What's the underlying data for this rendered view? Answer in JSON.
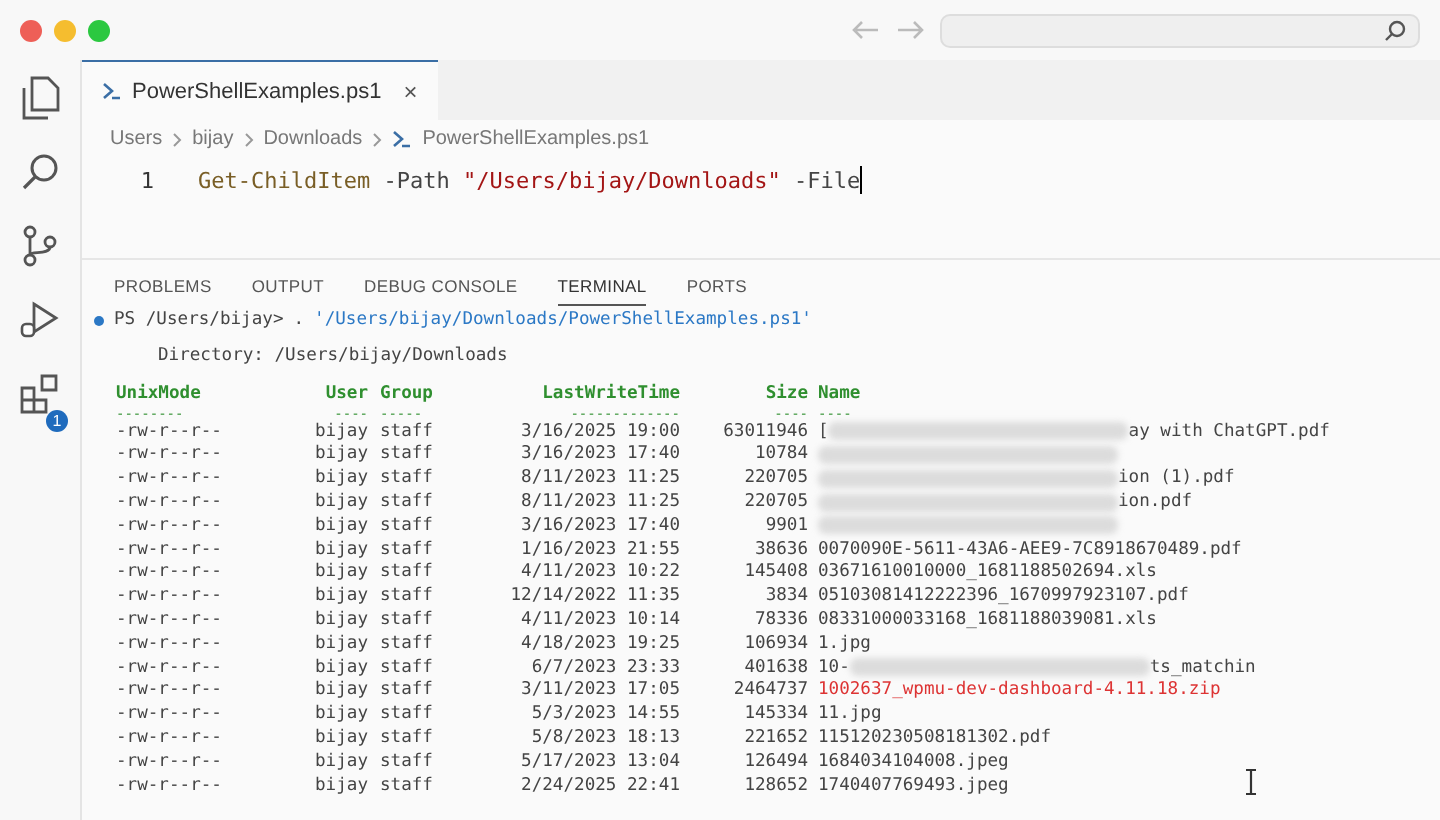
{
  "activity_bar": [
    {
      "kind": "files",
      "selected": false
    },
    {
      "kind": "search",
      "selected": false
    },
    {
      "kind": "branch",
      "selected": false
    },
    {
      "kind": "run",
      "selected": false
    },
    {
      "kind": "extensions",
      "selected": false,
      "badge": "1"
    }
  ],
  "editor_tab": {
    "label": "PowerShellExamples.ps1",
    "close": "×"
  },
  "breadcrumb": [
    "Users",
    "bijay",
    "Downloads",
    "PowerShellExamples.ps1"
  ],
  "code": {
    "line_number": "1",
    "tokens": [
      {
        "kind": "cmd",
        "text": "Get-ChildItem"
      },
      {
        "kind": "param",
        "text": "-Path"
      },
      {
        "kind": "string",
        "text": "\"/Users/bijay/Downloads\""
      },
      {
        "kind": "param",
        "text": "-File"
      }
    ]
  },
  "panel_tabs": [
    {
      "label": "PROBLEMS",
      "selected": false
    },
    {
      "label": "OUTPUT",
      "selected": false
    },
    {
      "label": "DEBUG CONSOLE",
      "selected": false
    },
    {
      "label": "TERMINAL",
      "selected": true
    },
    {
      "label": "PORTS",
      "selected": false
    }
  ],
  "terminal": {
    "prompt": "PS /Users/bijay>",
    "command": ".",
    "argument": "'/Users/bijay/Downloads/PowerShellExamples.ps1'",
    "directory": "Directory: /Users/bijay/Downloads",
    "columns": [
      {
        "label": "UnixMode",
        "underline": "--------"
      },
      {
        "label": "User",
        "underline": "----"
      },
      {
        "label": "Group",
        "underline": "-----"
      },
      {
        "label": "LastWriteTime",
        "underline": "-------------"
      },
      {
        "label": "Size",
        "underline": "----"
      },
      {
        "label": "Name",
        "underline": "----"
      }
    ],
    "rows": [
      {
        "mode": "-rw-r--r--",
        "user": "bijay",
        "group": "staff",
        "time": "3/16/2025 19:00",
        "size": "63011946",
        "name_start": "[",
        "redacted": true,
        "name_end": "ay with ChatGPT.pdf",
        "highlight": false
      },
      {
        "mode": "-rw-r--r--",
        "user": "bijay",
        "group": "staff",
        "time": "3/16/2023 17:40",
        "size": "10784",
        "redacted": true,
        "highlight": false
      },
      {
        "mode": "-rw-r--r--",
        "user": "bijay",
        "group": "staff",
        "time": "8/11/2023 11:25",
        "size": "220705",
        "redacted": true,
        "name_end": "ion (1).pdf",
        "highlight": false
      },
      {
        "mode": "-rw-r--r--",
        "user": "bijay",
        "group": "staff",
        "time": "8/11/2023 11:25",
        "size": "220705",
        "redacted": true,
        "name_end": "ion.pdf",
        "highlight": false
      },
      {
        "mode": "-rw-r--r--",
        "user": "bijay",
        "group": "staff",
        "time": "3/16/2023 17:40",
        "size": "9901",
        "redacted": true,
        "highlight": false
      },
      {
        "mode": "-rw-r--r--",
        "user": "bijay",
        "group": "staff",
        "time": "1/16/2023 21:55",
        "size": "38636",
        "name_start": "0070090E-5611-43A6-AEE9-7C8918670489.pdf",
        "redacted": false,
        "highlight": false
      },
      {
        "mode": "-rw-r--r--",
        "user": "bijay",
        "group": "staff",
        "time": "4/11/2023 10:22",
        "size": "145408",
        "name_start": "03671610010000_1681188502694.xls",
        "redacted": false,
        "highlight": false
      },
      {
        "mode": "-rw-r--r--",
        "user": "bijay",
        "group": "staff",
        "time": "12/14/2022 11:35",
        "size": "3834",
        "name_start": "05103081412222396_1670997923107.pdf",
        "redacted": false,
        "highlight": false
      },
      {
        "mode": "-rw-r--r--",
        "user": "bijay",
        "group": "staff",
        "time": "4/11/2023 10:14",
        "size": "78336",
        "name_start": "08331000033168_1681188039081.xls",
        "redacted": false,
        "highlight": false
      },
      {
        "mode": "-rw-r--r--",
        "user": "bijay",
        "group": "staff",
        "time": "4/18/2023 19:25",
        "size": "106934",
        "name_start": "1.jpg",
        "redacted": false,
        "highlight": false
      },
      {
        "mode": "-rw-r--r--",
        "user": "bijay",
        "group": "staff",
        "time": "6/7/2023 23:33",
        "size": "401638",
        "name_start": "10-",
        "redacted": true,
        "name_end": "ts_matchin",
        "highlight": false
      },
      {
        "mode": "-rw-r--r--",
        "user": "bijay",
        "group": "staff",
        "time": "3/11/2023 17:05",
        "size": "2464737",
        "name_start": "1002637_wpmu-dev-dashboard-4.11.18.zip",
        "redacted": false,
        "highlight": true
      },
      {
        "mode": "-rw-r--r--",
        "user": "bijay",
        "group": "staff",
        "time": "5/3/2023 14:55",
        "size": "145334",
        "name_start": "11.jpg",
        "redacted": false,
        "highlight": false
      },
      {
        "mode": "-rw-r--r--",
        "user": "bijay",
        "group": "staff",
        "time": "5/8/2023 18:13",
        "size": "221652",
        "name_start": "115120230508181302.pdf",
        "redacted": false,
        "highlight": false
      },
      {
        "mode": "-rw-r--r--",
        "user": "bijay",
        "group": "staff",
        "time": "5/17/2023 13:04",
        "size": "126494",
        "name_start": "1684034104008.jpeg",
        "redacted": false,
        "highlight": false
      },
      {
        "mode": "-rw-r--r--",
        "user": "bijay",
        "group": "staff",
        "time": "2/24/2025 22:41",
        "size": "128652",
        "name_start": "1740407769493.jpeg",
        "redacted": false,
        "highlight": false
      }
    ]
  }
}
